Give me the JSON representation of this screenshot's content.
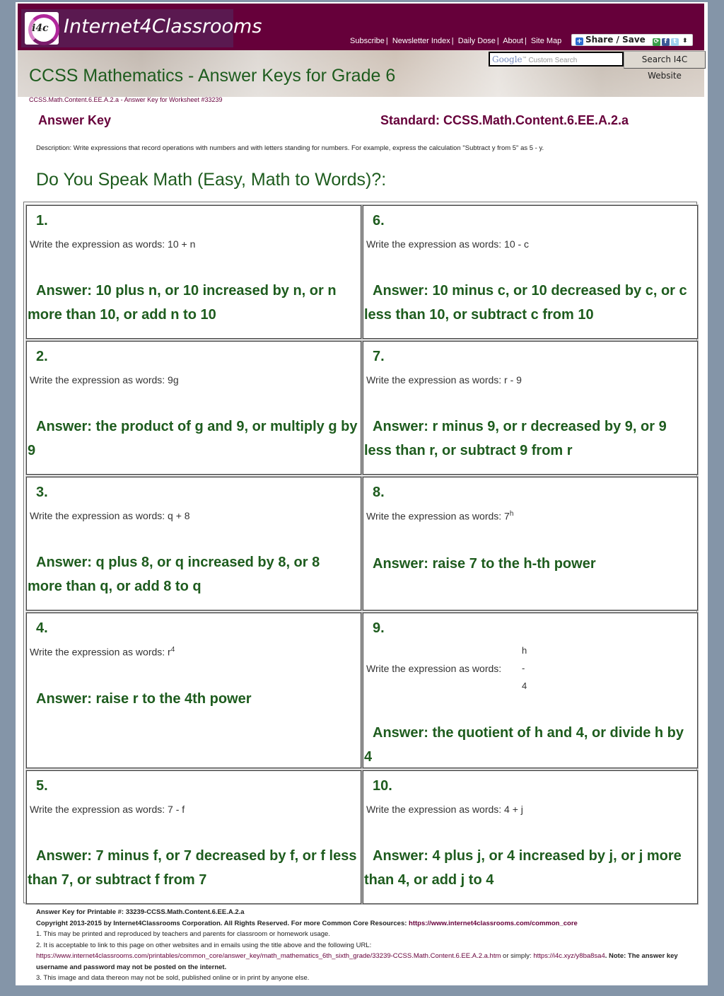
{
  "header": {
    "logo_emblem": "i4c",
    "logo_text": "Internet4Classrooms",
    "nav": [
      {
        "label": "Subscribe"
      },
      {
        "label": "Newsletter Index"
      },
      {
        "label": "Daily Dose"
      },
      {
        "label": "About"
      },
      {
        "label": "Site Map"
      }
    ],
    "share_label": "Share / Save",
    "search": {
      "placeholder_brand": "Google",
      "placeholder": "Custom Search",
      "button_label": "Search I4C Website"
    },
    "page_title": "CCSS Mathematics - Answer Keys for Grade 6"
  },
  "breadcrumb": "CCSS.Math.Content.6.EE.A.2.a - Answer Key for Worksheet #33239",
  "answer_key_label": "Answer Key",
  "standard_label": "Standard: CCSS.Math.Content.6.EE.A.2.a",
  "description": "Description: Write expressions that record operations with numbers and with letters standing for numbers. For example, express the calculation \"Subtract y from 5\" as 5 - y.",
  "section_title": "Do You Speak Math (Easy, Math to Words)?:",
  "prompt_prefix": "Write the expression as words: ",
  "questions": [
    {
      "num": "1.",
      "expr": "10 + n",
      "answer": "Answer: 10 plus n, or 10 increased by n, or n more than 10, or add n to 10"
    },
    {
      "num": "2.",
      "expr": "9g",
      "answer": "Answer: the product of g and 9, or multiply g by 9"
    },
    {
      "num": "3.",
      "expr": "q + 8",
      "answer": "Answer: q plus 8, or q increased by 8, or 8 more than q, or add 8 to q"
    },
    {
      "num": "4.",
      "expr_base": "r",
      "expr_sup": "4",
      "answer": "Answer: raise r to the 4th power"
    },
    {
      "num": "5.",
      "expr": "7 - f",
      "answer": "Answer: 7 minus f, or 7 decreased by f, or f less than 7, or subtract f from 7"
    },
    {
      "num": "6.",
      "expr": "10 - c",
      "answer": "Answer: 10 minus c, or 10 decreased by c, or c less than 10, or subtract c from 10"
    },
    {
      "num": "7.",
      "expr": "r - 9",
      "answer": "Answer: r minus 9, or r decreased by 9, or 9 less than r, or subtract 9 from r"
    },
    {
      "num": "8.",
      "expr_base": "7",
      "expr_sup": "h",
      "answer": "Answer: raise 7 to the h-th power"
    },
    {
      "num": "9.",
      "frac_num": "h",
      "frac_bar": "-",
      "frac_den": "4",
      "answer": "Answer: the quotient of h and 4, or divide h by 4"
    },
    {
      "num": "10.",
      "expr": "4 + j",
      "answer": "Answer: 4 plus j, or 4 increased by j, or j more than 4, or add j to 4"
    }
  ],
  "footer": {
    "printable": "Answer Key for Printable #: 33239-CCSS.Math.Content.6.EE.A.2.a",
    "copyright": "Copyright 2013-2015 by Internet4Classrooms Corporation. All Rights Reserved. For more Common Core Resources: ",
    "copyright_link": "https://www.internet4classrooms.com/common_core",
    "note1": "1. This may be printed and reproduced by teachers and parents for classroom or homework usage.",
    "note2": "2. It is acceptable to link to this page on other websites and in emails using the title above and the following URL:",
    "url_long": "https://www.internet4classrooms.com/printables/common_core/answer_key/math_mathematics_6th_sixth_grade/33239-CCSS.Math.Content.6.EE.A.2.a.htm",
    "or_simply": " or simply: ",
    "url_short": "https://i4c.xyz/y8ba8sa4",
    "note_warning": ". Note: The answer key username and password may not be posted on the internet.",
    "note3": "3. This image and data thereon may not be sold, published online or in print by anyone else."
  },
  "colors": {
    "brand": "#66003a",
    "heading_green": "#1e5c1e",
    "background": "#8495a8"
  }
}
